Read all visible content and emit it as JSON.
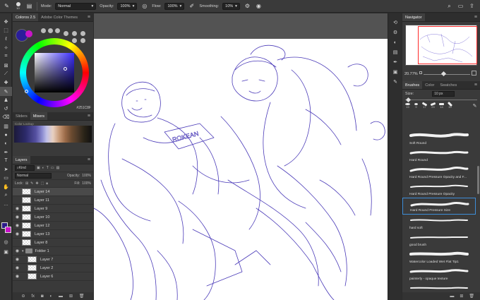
{
  "optionsbar": {
    "brush_size": "10",
    "mode_label": "Mode:",
    "mode_value": "Normal",
    "opacity_label": "Opacity:",
    "opacity_value": "100%",
    "flow_label": "Flow:",
    "flow_value": "100%",
    "smoothing_label": "Smoothing:",
    "smoothing_value": "10%"
  },
  "color_panel": {
    "tabs": [
      "Coloros 2.5",
      "Adobe Color Themes"
    ],
    "hex": "#251C8F",
    "foreground": "#2a1e9a",
    "background": "#c815c8"
  },
  "mixer_panel": {
    "tabs": [
      "Sliders",
      "Mixers"
    ],
    "strip_label": "Color Lookup"
  },
  "layers_panel": {
    "title": "Layers",
    "kind_label": "Kind",
    "blend_mode": "Normal",
    "opacity_label": "Opacity:",
    "opacity_value": "100%",
    "lock_label": "Lock:",
    "fill_label": "Fill:",
    "fill_value": "100%",
    "layers": [
      {
        "name": "Layer 14",
        "visible": false,
        "selected": true,
        "type": "layer"
      },
      {
        "name": "Layer 11",
        "visible": false,
        "selected": false,
        "type": "layer"
      },
      {
        "name": "Layer 9",
        "visible": true,
        "selected": false,
        "type": "layer"
      },
      {
        "name": "Layer 10",
        "visible": true,
        "selected": false,
        "type": "layer"
      },
      {
        "name": "Layer 12",
        "visible": true,
        "selected": false,
        "type": "layer"
      },
      {
        "name": "Layer 13",
        "visible": true,
        "selected": false,
        "type": "layer"
      },
      {
        "name": "Layer 8",
        "visible": false,
        "selected": false,
        "type": "layer"
      },
      {
        "name": "Folder 1",
        "visible": true,
        "selected": false,
        "type": "folder"
      },
      {
        "name": "Layer 7",
        "visible": true,
        "selected": false,
        "type": "layer"
      },
      {
        "name": "Layer 2",
        "visible": true,
        "selected": false,
        "type": "layer"
      },
      {
        "name": "Layer 6",
        "visible": true,
        "selected": false,
        "type": "layer"
      }
    ]
  },
  "navigator": {
    "title": "Navigator",
    "zoom": "20.77%"
  },
  "brushes_panel": {
    "tabs": [
      "Brushes",
      "Color",
      "Swatches"
    ],
    "size_label": "Size:",
    "size_value": "10 px",
    "preset_numbers": [
      "19",
      "9",
      "17",
      "29",
      "14",
      "30"
    ],
    "brushes": [
      {
        "name": "Soft Round",
        "selected": false
      },
      {
        "name": "Hard Round",
        "selected": false
      },
      {
        "name": "Hard Round Pressure Opacity and F...",
        "selected": false
      },
      {
        "name": "Hard Round Pressure Opacity",
        "selected": false
      },
      {
        "name": "Hard Round Pressure Size",
        "selected": true
      },
      {
        "name": "hard soft",
        "selected": false
      },
      {
        "name": "good brush",
        "selected": false
      },
      {
        "name": "Watercolor Loaded Wet Flat Tip1",
        "selected": false
      },
      {
        "name": "painterly - opaque texture",
        "selected": false
      },
      {
        "name": "林本液体 1 979",
        "selected": false
      }
    ]
  },
  "canvas": {
    "background": "#ffffff",
    "line_color": "#4a3ab8"
  }
}
